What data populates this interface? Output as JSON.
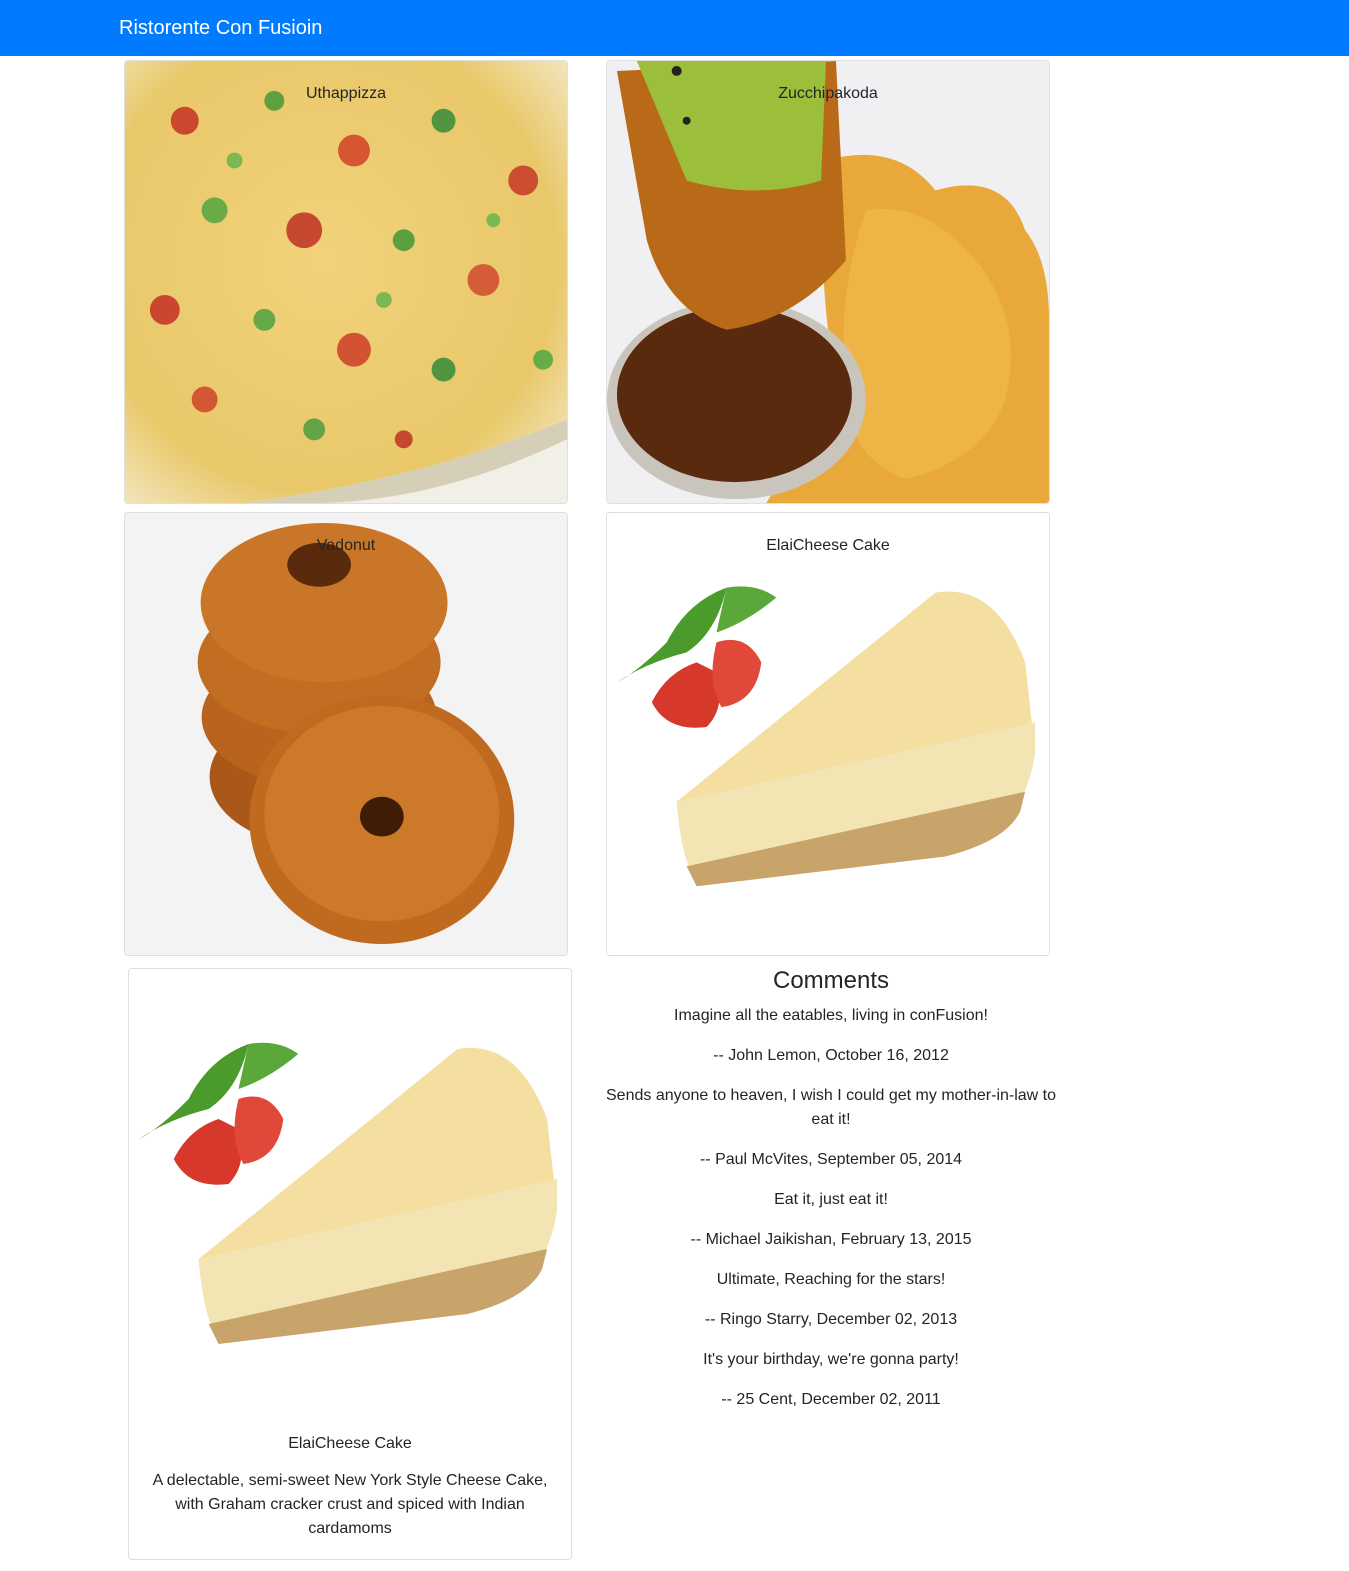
{
  "navbar": {
    "brand": "Ristorente Con Fusioin",
    "background_color": "#007bff"
  },
  "menu": {
    "dishes": [
      {
        "name": "Uthappizza",
        "image": "uthappizza"
      },
      {
        "name": "Zucchipakoda",
        "image": "zucchipakoda"
      },
      {
        "name": "Vadonut",
        "image": "vadonut"
      },
      {
        "name": "ElaiCheese Cake",
        "image": "elaicheese-cake"
      }
    ]
  },
  "selected_dish": {
    "name": "ElaiCheese Cake",
    "description": "A delectable, semi-sweet New York Style Cheese Cake, with Graham cracker crust and spiced with Indian cardamoms"
  },
  "comments": {
    "heading": "Comments",
    "items": [
      {
        "text": "Imagine all the eatables, living in conFusion!",
        "byline": "-- John Lemon,  October 16, 2012"
      },
      {
        "text": "Sends anyone to heaven, I wish I could get my mother-in-law to eat it!",
        "byline": "-- Paul McVites,  September 05, 2014"
      },
      {
        "text": "Eat it, just eat it!",
        "byline": "-- Michael Jaikishan,  February 13, 2015"
      },
      {
        "text": "Ultimate, Reaching for the stars!",
        "byline": "-- Ringo Starry,  December 02, 2013"
      },
      {
        "text": "It's your birthday, we're gonna party!",
        "byline": "-- 25 Cent,  December 02, 2011"
      }
    ]
  }
}
